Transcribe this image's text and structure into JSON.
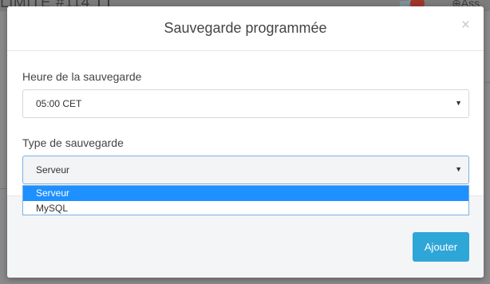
{
  "background": {
    "title_fragment": "LIMITE #114",
    "help_fragment": "Ass"
  },
  "modal": {
    "title": "Sauvegarde programmée",
    "close_symbol": "×",
    "time_field": {
      "label": "Heure de la sauvegarde",
      "value": "05:00 CET"
    },
    "type_field": {
      "label": "Type de sauvegarde",
      "value": "Serveur",
      "options": [
        "Serveur",
        "MySQL"
      ],
      "selected_index": 0
    },
    "submit_label": "Ajouter"
  },
  "colors": {
    "primary_button": "#2fa6d8",
    "selected_option": "#1e90ff"
  },
  "icons": [
    "edit-icon",
    "cart-icon",
    "help-icon",
    "close-icon",
    "caret-down-icon"
  ]
}
